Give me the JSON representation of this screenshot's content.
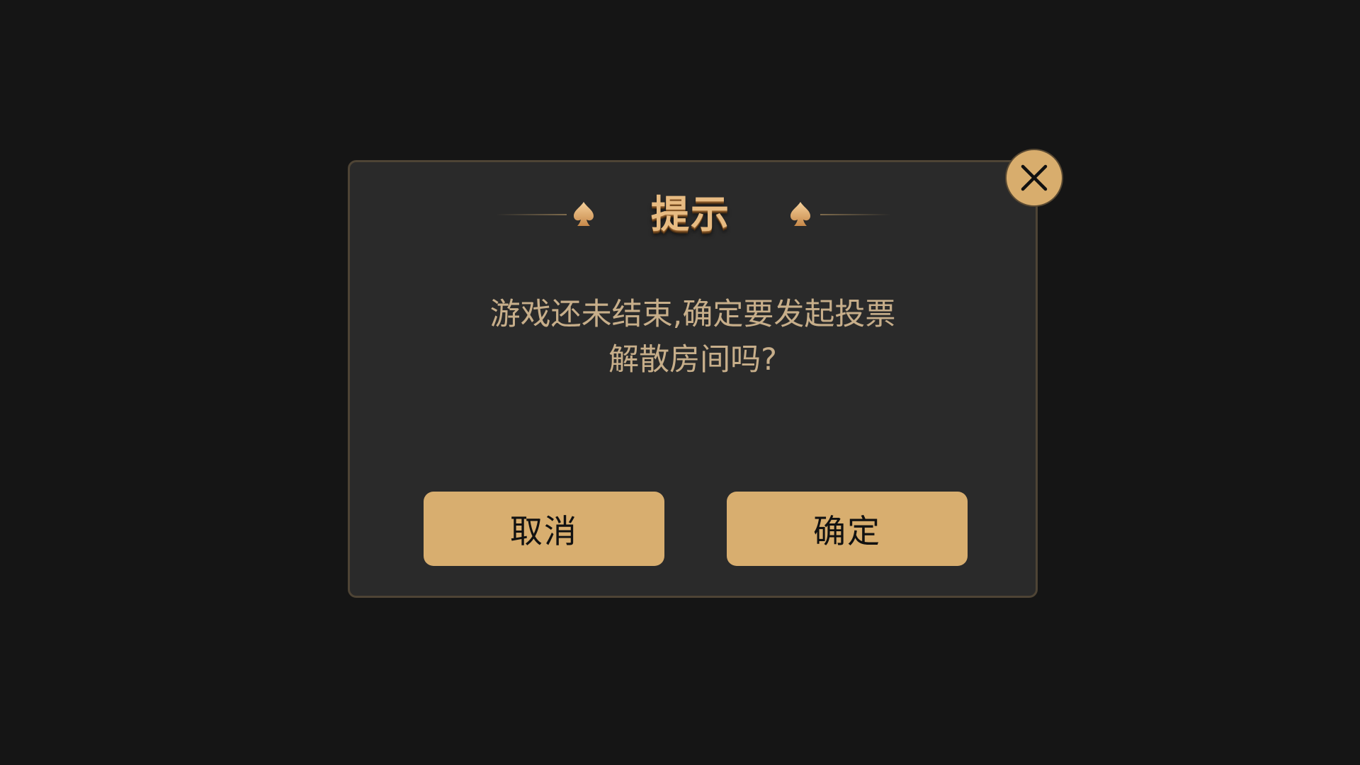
{
  "dialog": {
    "title": "提示",
    "message_line1": "游戏还未结束,确定要发起投票",
    "message_line2": "解散房间吗?",
    "cancel_label": "取消",
    "confirm_label": "确定",
    "close_icon": "close-icon",
    "decor_icon": "spade-icon"
  },
  "colors": {
    "background": "#151515",
    "panel": "#2a2a2a",
    "panel_border": "#4e4435",
    "accent_gold": "#d8ae6f",
    "message_text": "#c7ae8a",
    "title_text": "#e7bb82"
  }
}
